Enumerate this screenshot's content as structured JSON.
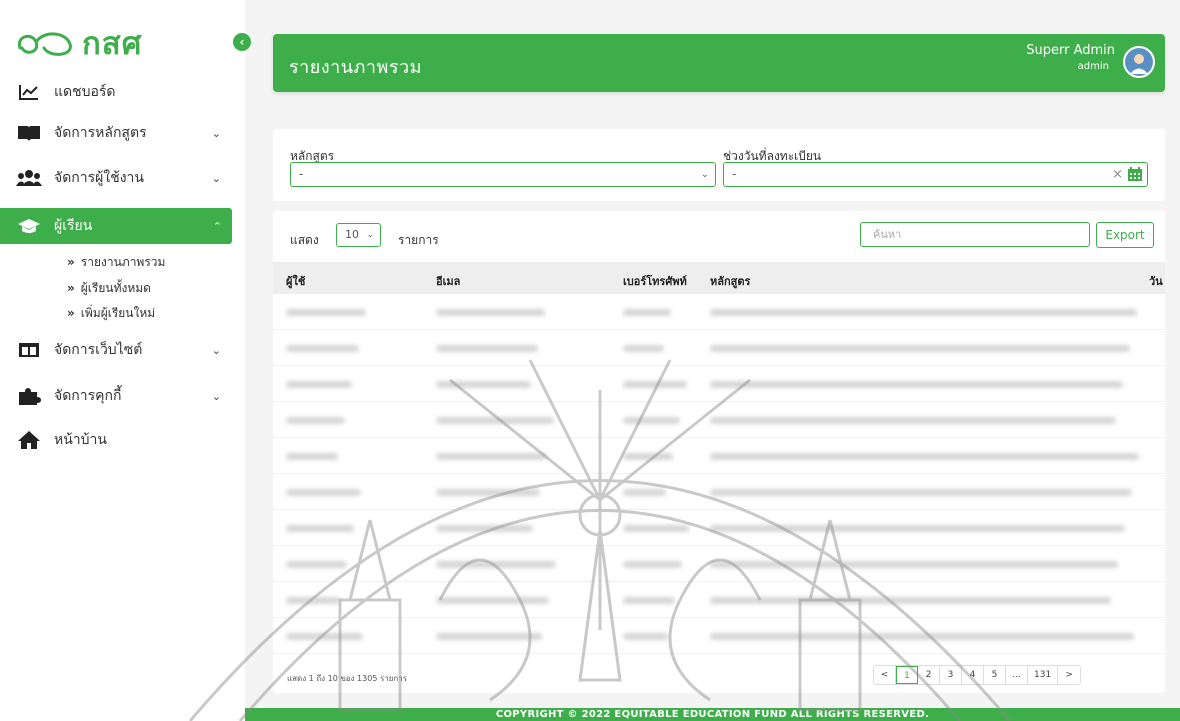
{
  "brand": {
    "name": "กสศ"
  },
  "sidebar": {
    "items": [
      {
        "label": "แดชบอร์ด",
        "icon": "chart-line-icon",
        "chevron": ""
      },
      {
        "label": "จัดการหลักสูตร",
        "icon": "book-icon",
        "chevron": "⌄"
      },
      {
        "label": "จัดการผู้ใช้งาน",
        "icon": "users-icon",
        "chevron": "⌄"
      },
      {
        "label": "ผู้เรียน",
        "icon": "graduation-cap-icon",
        "chevron": "⌃"
      },
      {
        "label": "จัดการเว็บไซต์",
        "icon": "layout-icon",
        "chevron": "⌄"
      },
      {
        "label": "จัดการคุกกี้",
        "icon": "puzzle-icon",
        "chevron": "⌄"
      },
      {
        "label": "หน้าบ้าน",
        "icon": "home-icon",
        "chevron": ""
      }
    ],
    "sub_items": [
      {
        "label": "รายงานภาพรวม"
      },
      {
        "label": "ผู้เรียนทั้งหมด"
      },
      {
        "label": "เพิ่มผู้เรียนใหม่"
      }
    ]
  },
  "header": {
    "title": "รายงานภาพรวม",
    "user_name": "Superr Admin",
    "user_role": "admin"
  },
  "filters": {
    "course_label": "หลักสูตร",
    "course_value": "-",
    "date_label": "ช่วงวันที่ลงทะเบียน",
    "date_value": "-",
    "clear_symbol": "×"
  },
  "table": {
    "show_label": "แสดง",
    "page_length": "10",
    "items_label": "รายการ",
    "search_placeholder": "ค้นหา",
    "export_label": "Export",
    "columns": [
      "ผู้ใช้",
      "อีเมล",
      "เบอร์โทรศัพท์",
      "หลักสูตร",
      "วัน"
    ],
    "info": "แสดง 1 ถึง 10 ของ 1305 รายการ",
    "pagination": [
      "<",
      "1",
      "2",
      "3",
      "4",
      "5",
      "...",
      "131",
      ">"
    ]
  },
  "footer": {
    "text": "COPYRIGHT © 2022 EQUITABLE EDUCATION FUND ALL RIGHTS RESERVED."
  },
  "colors": {
    "primary": "#3dae4a",
    "background": "#f3f4f3"
  }
}
